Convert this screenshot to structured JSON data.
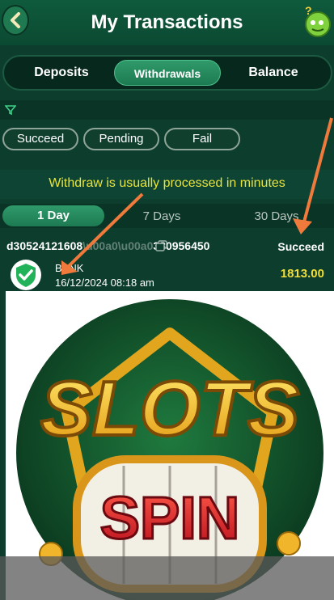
{
  "header": {
    "title": "My Transactions"
  },
  "tabs": [
    {
      "label": "Deposits",
      "active": false
    },
    {
      "label": "Withdrawals",
      "active": true
    },
    {
      "label": "Balance",
      "active": false
    }
  ],
  "status_filters": [
    "Succeed",
    "Pending",
    "Fail"
  ],
  "notice": "Withdraw is usually processed in minutes",
  "ranges": [
    {
      "label": "1 Day",
      "active": true
    },
    {
      "label": "7 Days",
      "active": false
    },
    {
      "label": "30 Days",
      "active": false
    }
  ],
  "transaction": {
    "id": "d305241216081...80956450",
    "id_visible": "d30524121608",
    "id_end": "380956450",
    "status": "Succeed",
    "method": "BANK",
    "date": "16/12/2024 08:18 am",
    "amount": "1813.00"
  },
  "promo": {
    "line1": "SLOTS",
    "line2": "SPIN"
  },
  "colors": {
    "accent_green": "#1d7a52",
    "notice_yellow": "#e8e43a",
    "amount_yellow": "#f2de3a",
    "annotation_arrow": "#f07a3c"
  }
}
